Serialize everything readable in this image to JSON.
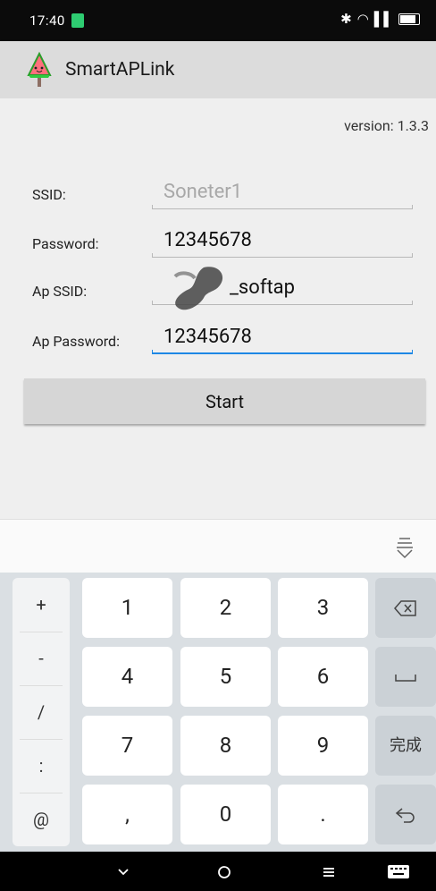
{
  "status_bar": {
    "time": "17:40",
    "right_icons": [
      "bluetooth-icon",
      "wifi-icon",
      "signal-icon",
      "battery-icon"
    ]
  },
  "app_bar": {
    "title": "SmartAPLink",
    "logo": "watermelon-logo-icon"
  },
  "form": {
    "version": "version: 1.3.3",
    "ssid": {
      "label": "SSID:",
      "value": "Soneter1"
    },
    "password": {
      "label": "Password:",
      "value": "12345678"
    },
    "ap_ssid": {
      "label": "Ap SSID:",
      "value": "_softap"
    },
    "ap_password": {
      "label": "Ap Password:",
      "value": "12345678"
    },
    "start_label": "Start"
  },
  "keyboard": {
    "hide_icon": "keyboard-hide-icon",
    "symbols": [
      "+",
      "-",
      "/",
      ":",
      "@"
    ],
    "keys": [
      "1",
      "2",
      "3",
      "4",
      "5",
      "6",
      "7",
      "8",
      "9",
      ",",
      "0",
      "."
    ],
    "delete_icon": "backspace-icon",
    "space_icon": "space-icon",
    "done_label": "完成",
    "enter_icon": "enter-icon"
  },
  "nav_bar": {
    "icons": [
      "chevron-down-icon",
      "home-circle-icon",
      "menu-icon",
      "keyboard-icon"
    ]
  },
  "colors": {
    "accent": "#1e88e5",
    "status_green": "#2ecc71",
    "app_bar": "#dcdcdc",
    "content_bg": "#efefef"
  }
}
